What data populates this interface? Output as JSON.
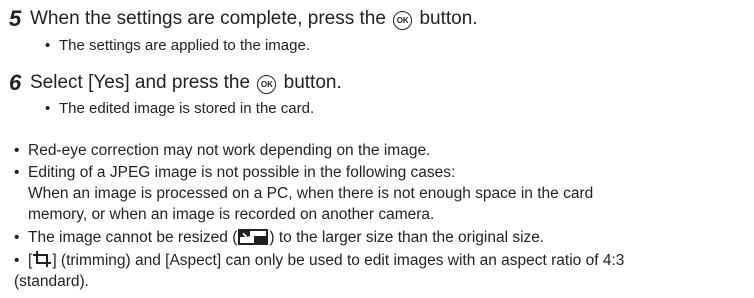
{
  "steps": [
    {
      "number": "5",
      "text_before": "When the settings are complete, press the",
      "icon": "ok-button-icon",
      "icon_label": "OK",
      "text_after": "button.",
      "sub": "The settings are applied to the image."
    },
    {
      "number": "6",
      "text_before": "Select [Yes] and press the",
      "icon": "ok-button-icon",
      "icon_label": "OK",
      "text_after": "button.",
      "sub": "The edited image is stored in the card."
    }
  ],
  "notes": {
    "bullet": "•",
    "n1": "Red-eye correction may not work depending on the image.",
    "n2": "Editing of a JPEG image is not possible in the following cases:",
    "n2_cont_1": "When an image is processed on a PC, when there is not enough space in the card",
    "n2_cont_2": "memory, or when an image is recorded on another camera.",
    "n3_before": "The image cannot be resized (",
    "n3_icon": "resize-icon",
    "n3_after": ") to the larger size than the original size.",
    "n4_before": "[",
    "n4_icon": "trimming-icon",
    "n4_after": "] (trimming) and [Aspect] can only be used to edit images with an aspect ratio of 4:3",
    "n4_cont": "(standard)."
  }
}
